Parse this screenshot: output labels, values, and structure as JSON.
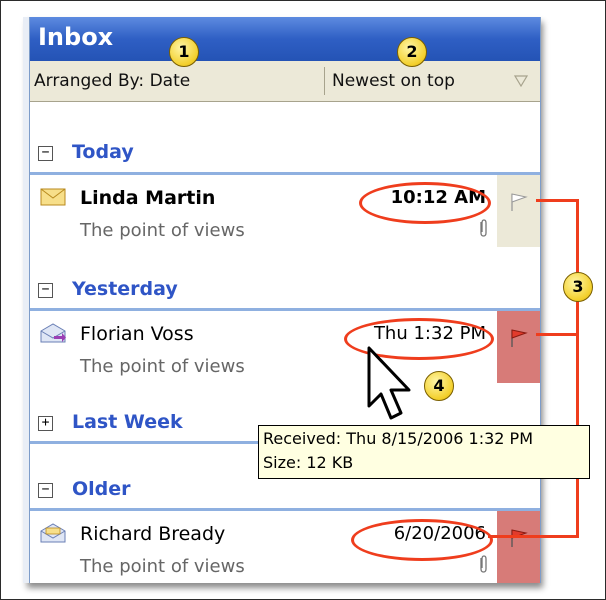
{
  "inbox": {
    "title": "Inbox",
    "arranged_by": "Arranged By: Date",
    "sort_order": "Newest on top"
  },
  "groups": [
    {
      "label": "Today",
      "expander": "−"
    },
    {
      "label": "Yesterday",
      "expander": "−"
    },
    {
      "label": "Last Week",
      "expander": "+"
    },
    {
      "label": "Older",
      "expander": "−"
    }
  ],
  "messages": [
    {
      "sender": "Linda Martin",
      "preview": "The point of views",
      "time": "10:12 AM",
      "unread": true,
      "icon": "closed-envelope-icon",
      "has_attachment": true,
      "flag": "empty"
    },
    {
      "sender": "Florian Voss",
      "preview": "The point of views",
      "time": "Thu 1:32 PM",
      "unread": false,
      "icon": "replied-envelope-icon",
      "has_attachment": false,
      "flag": "red"
    },
    {
      "sender": "Richard Bready",
      "preview": "The point of views",
      "time": "6/20/2006",
      "unread": false,
      "icon": "opened-envelope-icon",
      "has_attachment": true,
      "flag": "red"
    }
  ],
  "tooltip": {
    "received": "Received: Thu 8/15/2006 1:32 PM",
    "size": "Size: 12 KB"
  },
  "callouts": [
    "1",
    "2",
    "3",
    "4"
  ],
  "colors": {
    "title_bar": "#2f5fc4",
    "group_text": "#2f55c6",
    "callout_red": "#ef3d1d",
    "flag_cell_red": "#d77b78",
    "tooltip_bg": "#ffffe1"
  }
}
